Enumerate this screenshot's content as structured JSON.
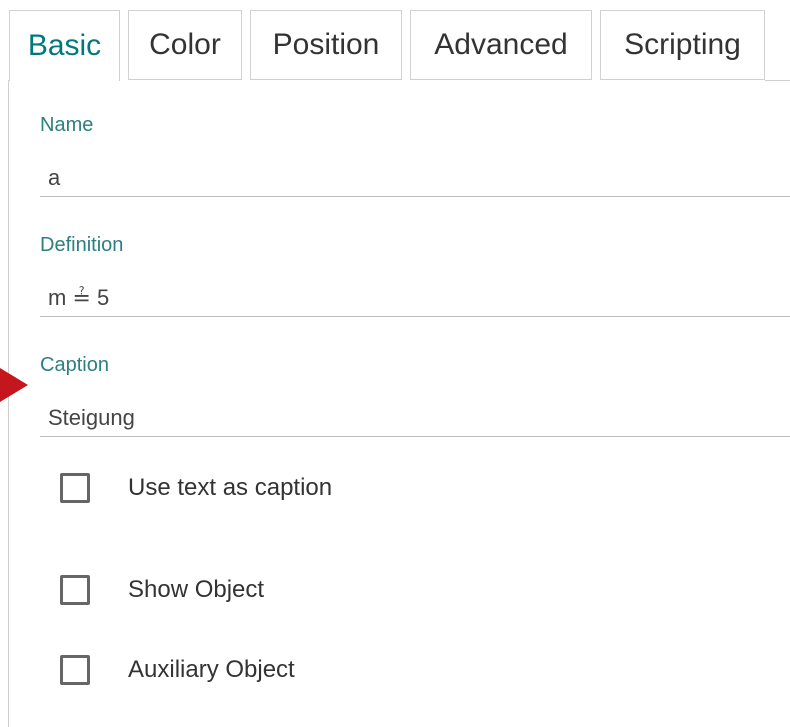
{
  "tabs": [
    {
      "label": "Basic",
      "active": true
    },
    {
      "label": "Color",
      "active": false
    },
    {
      "label": "Position",
      "active": false
    },
    {
      "label": "Advanced",
      "active": false
    },
    {
      "label": "Scripting",
      "active": false
    }
  ],
  "fields": {
    "name": {
      "label": "Name",
      "value": "a"
    },
    "definition": {
      "label": "Definition",
      "value": "m ≟ 5"
    },
    "caption": {
      "label": "Caption",
      "value": "Steigung"
    }
  },
  "checkboxes": {
    "use_text_as_caption": {
      "label": "Use text as caption",
      "checked": false
    },
    "show_object": {
      "label": "Show Object",
      "checked": false
    },
    "auxiliary_object": {
      "label": "Auxiliary Object",
      "checked": false
    }
  },
  "colors": {
    "accent": "#00797e",
    "label": "#2d7f80",
    "arrow": "#c4161c"
  }
}
